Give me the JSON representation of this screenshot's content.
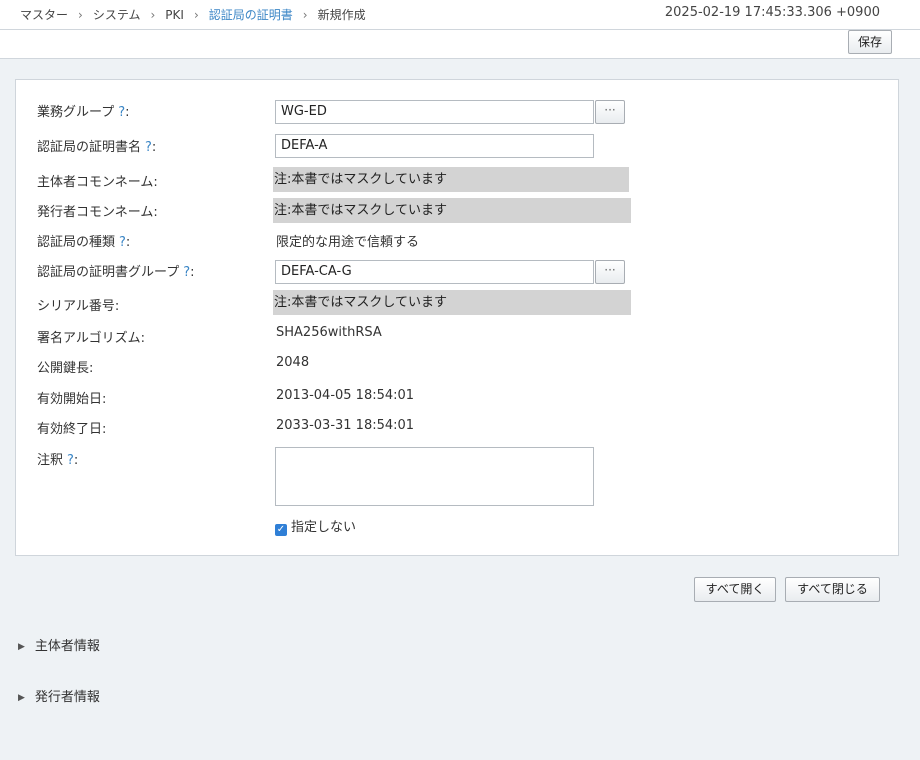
{
  "breadcrumb": {
    "items": [
      "マスター",
      "システム",
      "PKI",
      "認証局の証明書",
      "新規作成"
    ],
    "separator": "›"
  },
  "timestamp": "2025-02-19 17:45:33.306 +0900",
  "toolbar": {
    "save_label": "保存"
  },
  "help_mark": "?",
  "form": {
    "business_group": {
      "label": "業務グループ",
      "value": "WG-ED",
      "browse_label": "···"
    },
    "cert_name": {
      "label": "認証局の証明書名",
      "value": "DEFA-A"
    },
    "subject_cn": {
      "label": "主体者コモンネーム:",
      "value": "注:本書ではマスクしています"
    },
    "issuer_cn": {
      "label": "発行者コモンネーム:",
      "value": "注:本書ではマスクしています"
    },
    "ca_type": {
      "label": "認証局の種類",
      "value": "限定的な用途で信頼する"
    },
    "cert_group": {
      "label": "認証局の証明書グループ",
      "value": "DEFA-CA-G",
      "browse_label": "···"
    },
    "serial": {
      "label": "シリアル番号:",
      "value": "注:本書ではマスクしています"
    },
    "sig_alg": {
      "label": "署名アルゴリズム:",
      "value": "SHA256withRSA"
    },
    "key_length": {
      "label": "公開鍵長:",
      "value": "2048"
    },
    "valid_from": {
      "label": "有効開始日:",
      "value": "2013-04-05 18:54:01"
    },
    "valid_to": {
      "label": "有効終了日:",
      "value": "2033-03-31 18:54:01"
    },
    "note": {
      "label": "注釈",
      "value": ""
    },
    "unspecified": {
      "label": "指定しない",
      "checked": true
    }
  },
  "actions": {
    "expand_all": "すべて開く",
    "collapse_all": "すべて閉じる"
  },
  "sections": [
    {
      "label": "主体者情報",
      "expanded": false
    },
    {
      "label": "発行者情報",
      "expanded": false
    }
  ],
  "colors": {
    "link": "#3b86c6",
    "mask": "#d3d3d3",
    "background": "#eef2f5",
    "checkbox": "#2f7fd6"
  }
}
